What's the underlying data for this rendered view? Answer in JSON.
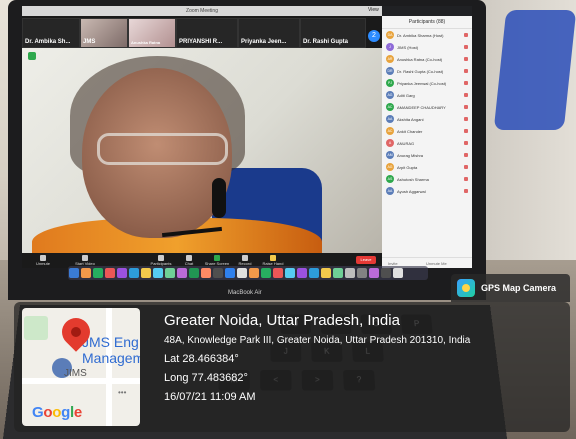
{
  "zoom": {
    "window_title": "Zoom Meeting",
    "view_label": "View",
    "gallery": [
      {
        "name": "Dr. Ambika Sh..."
      },
      {
        "name": "JMS"
      },
      {
        "name": "Anushka Ratna"
      },
      {
        "name": "PRIYANSHI R..."
      },
      {
        "name": "Priyanka Jeen..."
      },
      {
        "name": "Dr. Rashi Gupta"
      }
    ],
    "gallery_more": "2",
    "toolbar": [
      {
        "label": "Unmute"
      },
      {
        "label": "Start Video"
      },
      {
        "label": "Participants"
      },
      {
        "label": "Chat"
      },
      {
        "label": "Share Screen"
      },
      {
        "label": "Record"
      },
      {
        "label": "Raise Hand"
      }
    ],
    "leave_label": "Leave",
    "participants": {
      "title": "Participants (88)",
      "list": [
        {
          "initials": "DA",
          "name": "Dr. Ambika Sharma (Host)",
          "color": "#e8a33c"
        },
        {
          "initials": "J",
          "name": "JIMS (Host)",
          "color": "#8e6ad8"
        },
        {
          "initials": "AR",
          "name": "Anushka Ratna (Co-host)",
          "color": "#e8a33c"
        },
        {
          "initials": "DR",
          "name": "Dr. Rashi Gupta (Co-host)",
          "color": "#5b7db8"
        },
        {
          "initials": "PJ",
          "name": "Priyanka Jeenwal (Co-host)",
          "color": "#2ea84c"
        },
        {
          "initials": "AG",
          "name": "Aditi Garg",
          "color": "#5b7db8"
        },
        {
          "initials": "AC",
          "name": "AMANDEEP CHAUDHARY",
          "color": "#2ea84c"
        },
        {
          "initials": "AA",
          "name": "Akshita Angani",
          "color": "#5b7db8"
        },
        {
          "initials": "AC",
          "name": "Ankit Chander",
          "color": "#e8a33c"
        },
        {
          "initials": "A",
          "name": "ANURAG",
          "color": "#e06666"
        },
        {
          "initials": "AM",
          "name": "Anurag Mishra",
          "color": "#5b7db8"
        },
        {
          "initials": "AG",
          "name": "Arpit Gupta",
          "color": "#e8a33c"
        },
        {
          "initials": "AS",
          "name": "Ashutosh Sharma",
          "color": "#2ea84c"
        },
        {
          "initials": "AA",
          "name": "Ayush Aggarwal",
          "color": "#5b7db8"
        }
      ],
      "invite": "Invite",
      "unmute": "Unmute Me"
    }
  },
  "laptop_brand": "MacBook Air",
  "keyboard_keys": [
    "U",
    "I",
    "O",
    "P",
    "J",
    "K",
    "L",
    "M",
    "<",
    ">",
    "?"
  ],
  "gps": {
    "app_name": "GPS Map Camera",
    "map_label": "JMS Eng\nManagem",
    "map_label_line1": "JMS Eng",
    "map_label_line2": "Managem",
    "map_place": "JIMS",
    "google_logo": "Google",
    "city": "Greater Noida, Uttar Pradesh, India",
    "address": "48A, Knowledge Park III, Greater Noida, Uttar Pradesh 201310, India",
    "lat": "Lat 28.466384°",
    "long": "Long 77.483682°",
    "datetime": "16/07/21 11:09 AM"
  }
}
